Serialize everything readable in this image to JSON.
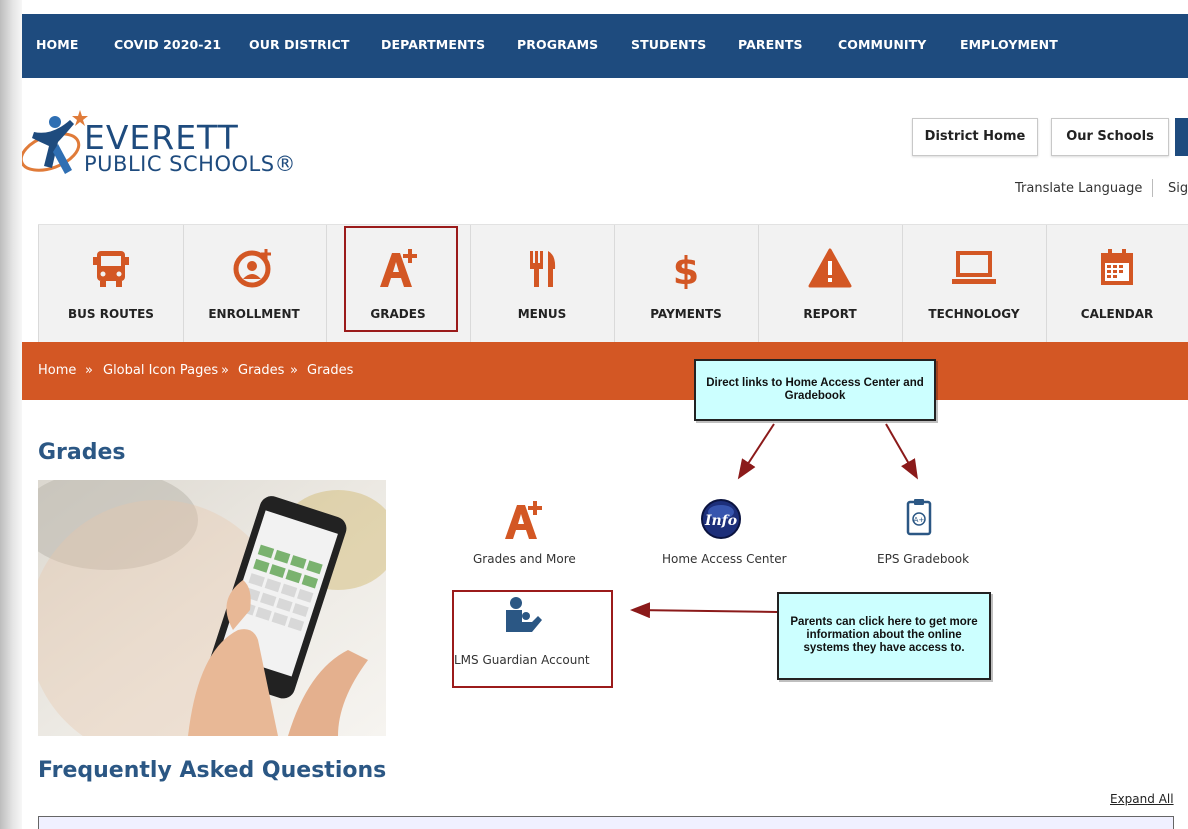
{
  "top_nav": [
    "HOME",
    "COVID 2020-21",
    "OUR DISTRICT",
    "DEPARTMENTS",
    "PROGRAMS",
    "STUDENTS",
    "PARENTS",
    "COMMUNITY",
    "EMPLOYMENT"
  ],
  "logo": {
    "line1": "EVERETT",
    "line2": "PUBLIC SCHOOLS®"
  },
  "header": {
    "district_home": "District Home",
    "our_schools": "Our Schools",
    "translate": "Translate Language",
    "sign_partial": "Sig"
  },
  "icon_bar": [
    {
      "label": "BUS ROUTES",
      "icon": "bus-icon"
    },
    {
      "label": "ENROLLMENT",
      "icon": "enrollment-plus-icon"
    },
    {
      "label": "GRADES",
      "icon": "a-plus-icon"
    },
    {
      "label": "MENUS",
      "icon": "fork-knife-icon"
    },
    {
      "label": "PAYMENTS",
      "icon": "dollar-icon"
    },
    {
      "label": "REPORT",
      "icon": "warning-icon"
    },
    {
      "label": "TECHNOLOGY",
      "icon": "laptop-icon"
    },
    {
      "label": "CALENDAR",
      "icon": "calendar-icon"
    }
  ],
  "breadcrumb": [
    "Home",
    "»",
    "Global Icon Pages",
    "»",
    "Grades",
    "»",
    "Grades"
  ],
  "page_title": "Grades",
  "tiles": {
    "grades_more": "Grades and More",
    "hac": "Home Access Center",
    "hac_icon_text": "Info",
    "gradebook": "EPS Gradebook",
    "lms": "LMS Guardian Account"
  },
  "callouts": {
    "direct": "Direct links to Home Access Center and Gradebook",
    "parents": "Parents can click here to get more information about the online systems they have access to."
  },
  "faq_title": "Frequently Asked Questions",
  "expand_all": "Expand All",
  "colors": {
    "nav": "#1e4b7e",
    "accent": "#d35724",
    "highlight": "#9b1b1b",
    "callout": "#ccffff"
  }
}
